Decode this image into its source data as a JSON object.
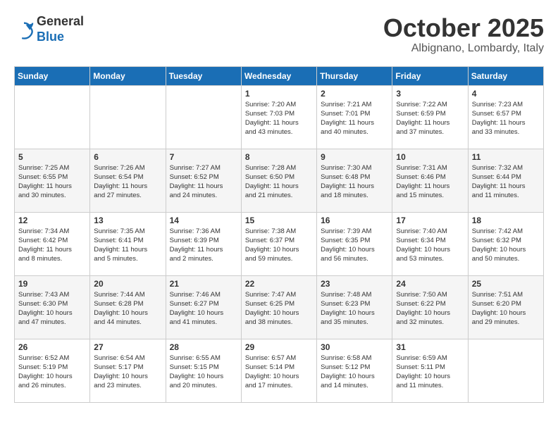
{
  "header": {
    "logo": {
      "line1": "General",
      "line2": "Blue"
    },
    "title": "October 2025",
    "location": "Albignano, Lombardy, Italy"
  },
  "weekdays": [
    "Sunday",
    "Monday",
    "Tuesday",
    "Wednesday",
    "Thursday",
    "Friday",
    "Saturday"
  ],
  "weeks": [
    [
      {
        "day": "",
        "info": ""
      },
      {
        "day": "",
        "info": ""
      },
      {
        "day": "",
        "info": ""
      },
      {
        "day": "1",
        "info": "Sunrise: 7:20 AM\nSunset: 7:03 PM\nDaylight: 11 hours\nand 43 minutes."
      },
      {
        "day": "2",
        "info": "Sunrise: 7:21 AM\nSunset: 7:01 PM\nDaylight: 11 hours\nand 40 minutes."
      },
      {
        "day": "3",
        "info": "Sunrise: 7:22 AM\nSunset: 6:59 PM\nDaylight: 11 hours\nand 37 minutes."
      },
      {
        "day": "4",
        "info": "Sunrise: 7:23 AM\nSunset: 6:57 PM\nDaylight: 11 hours\nand 33 minutes."
      }
    ],
    [
      {
        "day": "5",
        "info": "Sunrise: 7:25 AM\nSunset: 6:55 PM\nDaylight: 11 hours\nand 30 minutes."
      },
      {
        "day": "6",
        "info": "Sunrise: 7:26 AM\nSunset: 6:54 PM\nDaylight: 11 hours\nand 27 minutes."
      },
      {
        "day": "7",
        "info": "Sunrise: 7:27 AM\nSunset: 6:52 PM\nDaylight: 11 hours\nand 24 minutes."
      },
      {
        "day": "8",
        "info": "Sunrise: 7:28 AM\nSunset: 6:50 PM\nDaylight: 11 hours\nand 21 minutes."
      },
      {
        "day": "9",
        "info": "Sunrise: 7:30 AM\nSunset: 6:48 PM\nDaylight: 11 hours\nand 18 minutes."
      },
      {
        "day": "10",
        "info": "Sunrise: 7:31 AM\nSunset: 6:46 PM\nDaylight: 11 hours\nand 15 minutes."
      },
      {
        "day": "11",
        "info": "Sunrise: 7:32 AM\nSunset: 6:44 PM\nDaylight: 11 hours\nand 11 minutes."
      }
    ],
    [
      {
        "day": "12",
        "info": "Sunrise: 7:34 AM\nSunset: 6:42 PM\nDaylight: 11 hours\nand 8 minutes."
      },
      {
        "day": "13",
        "info": "Sunrise: 7:35 AM\nSunset: 6:41 PM\nDaylight: 11 hours\nand 5 minutes."
      },
      {
        "day": "14",
        "info": "Sunrise: 7:36 AM\nSunset: 6:39 PM\nDaylight: 11 hours\nand 2 minutes."
      },
      {
        "day": "15",
        "info": "Sunrise: 7:38 AM\nSunset: 6:37 PM\nDaylight: 10 hours\nand 59 minutes."
      },
      {
        "day": "16",
        "info": "Sunrise: 7:39 AM\nSunset: 6:35 PM\nDaylight: 10 hours\nand 56 minutes."
      },
      {
        "day": "17",
        "info": "Sunrise: 7:40 AM\nSunset: 6:34 PM\nDaylight: 10 hours\nand 53 minutes."
      },
      {
        "day": "18",
        "info": "Sunrise: 7:42 AM\nSunset: 6:32 PM\nDaylight: 10 hours\nand 50 minutes."
      }
    ],
    [
      {
        "day": "19",
        "info": "Sunrise: 7:43 AM\nSunset: 6:30 PM\nDaylight: 10 hours\nand 47 minutes."
      },
      {
        "day": "20",
        "info": "Sunrise: 7:44 AM\nSunset: 6:28 PM\nDaylight: 10 hours\nand 44 minutes."
      },
      {
        "day": "21",
        "info": "Sunrise: 7:46 AM\nSunset: 6:27 PM\nDaylight: 10 hours\nand 41 minutes."
      },
      {
        "day": "22",
        "info": "Sunrise: 7:47 AM\nSunset: 6:25 PM\nDaylight: 10 hours\nand 38 minutes."
      },
      {
        "day": "23",
        "info": "Sunrise: 7:48 AM\nSunset: 6:23 PM\nDaylight: 10 hours\nand 35 minutes."
      },
      {
        "day": "24",
        "info": "Sunrise: 7:50 AM\nSunset: 6:22 PM\nDaylight: 10 hours\nand 32 minutes."
      },
      {
        "day": "25",
        "info": "Sunrise: 7:51 AM\nSunset: 6:20 PM\nDaylight: 10 hours\nand 29 minutes."
      }
    ],
    [
      {
        "day": "26",
        "info": "Sunrise: 6:52 AM\nSunset: 5:19 PM\nDaylight: 10 hours\nand 26 minutes."
      },
      {
        "day": "27",
        "info": "Sunrise: 6:54 AM\nSunset: 5:17 PM\nDaylight: 10 hours\nand 23 minutes."
      },
      {
        "day": "28",
        "info": "Sunrise: 6:55 AM\nSunset: 5:15 PM\nDaylight: 10 hours\nand 20 minutes."
      },
      {
        "day": "29",
        "info": "Sunrise: 6:57 AM\nSunset: 5:14 PM\nDaylight: 10 hours\nand 17 minutes."
      },
      {
        "day": "30",
        "info": "Sunrise: 6:58 AM\nSunset: 5:12 PM\nDaylight: 10 hours\nand 14 minutes."
      },
      {
        "day": "31",
        "info": "Sunrise: 6:59 AM\nSunset: 5:11 PM\nDaylight: 10 hours\nand 11 minutes."
      },
      {
        "day": "",
        "info": ""
      }
    ]
  ]
}
